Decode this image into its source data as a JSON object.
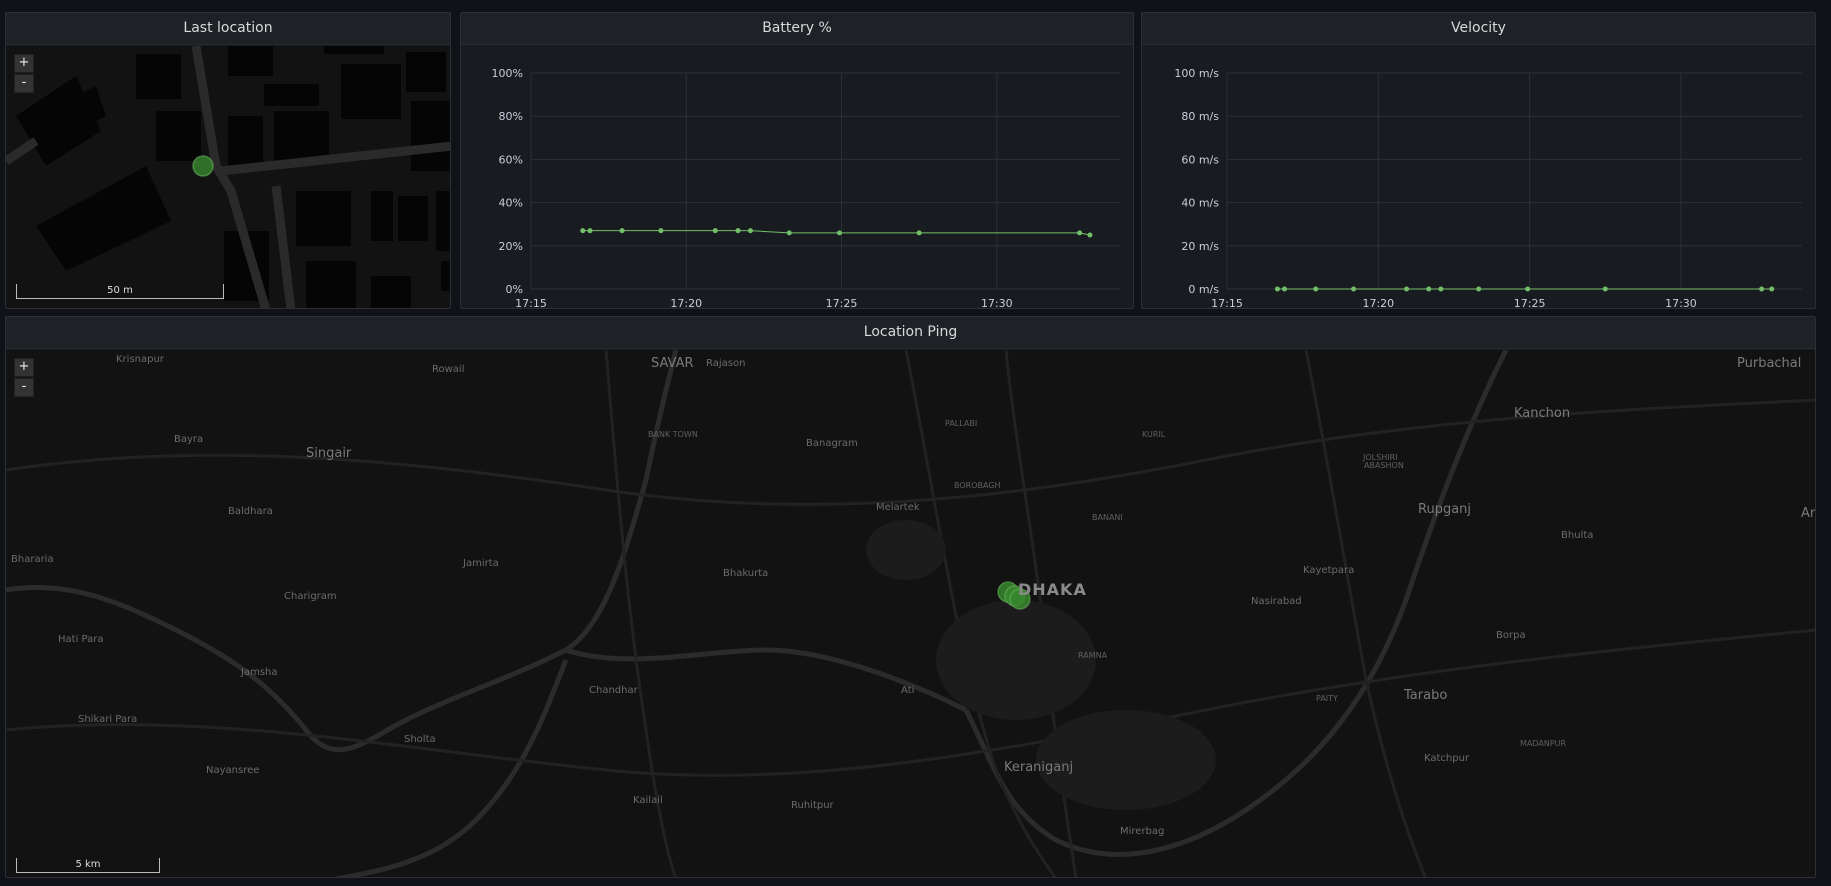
{
  "panels": {
    "last_location": {
      "title": "Last location",
      "zoom_in": "+",
      "zoom_out": "-",
      "scale": "50 m"
    },
    "battery": {
      "title": "Battery %"
    },
    "velocity": {
      "title": "Velocity"
    },
    "location_ping": {
      "title": "Location Ping",
      "zoom_in": "+",
      "zoom_out": "-",
      "scale": "5 km",
      "places": [
        {
          "name": "Krisnapur",
          "cls": ""
        },
        {
          "name": "Rowail",
          "cls": ""
        },
        {
          "name": "SAVAR",
          "cls": "big"
        },
        {
          "name": "Rajason",
          "cls": ""
        },
        {
          "name": "Purbachal",
          "cls": "big"
        },
        {
          "name": "Kanchon",
          "cls": "big"
        },
        {
          "name": "Bayra",
          "cls": ""
        },
        {
          "name": "Singair",
          "cls": "big"
        },
        {
          "name": "BANK TOWN",
          "cls": "sm"
        },
        {
          "name": "Banagram",
          "cls": ""
        },
        {
          "name": "PALLABI",
          "cls": "sm"
        },
        {
          "name": "KURIL",
          "cls": "sm"
        },
        {
          "name": "JOLSHIRI",
          "cls": "sm"
        },
        {
          "name": "ABASHON",
          "cls": "sm"
        },
        {
          "name": "BOROBAGH",
          "cls": "sm"
        },
        {
          "name": "Baldhara",
          "cls": ""
        },
        {
          "name": "Melartek",
          "cls": ""
        },
        {
          "name": "BANANI",
          "cls": "sm"
        },
        {
          "name": "Rupganj",
          "cls": "big"
        },
        {
          "name": "Bhulta",
          "cls": ""
        },
        {
          "name": "Ara",
          "cls": "big"
        },
        {
          "name": "Bhararia",
          "cls": ""
        },
        {
          "name": "Jamirta",
          "cls": ""
        },
        {
          "name": "Bhakurta",
          "cls": ""
        },
        {
          "name": "DHAKA",
          "cls": "city"
        },
        {
          "name": "Kayetpara",
          "cls": ""
        },
        {
          "name": "Charigram",
          "cls": ""
        },
        {
          "name": "Nasirabad",
          "cls": ""
        },
        {
          "name": "Hati Para",
          "cls": ""
        },
        {
          "name": "Borpa",
          "cls": ""
        },
        {
          "name": "RAMNA",
          "cls": "sm"
        },
        {
          "name": "Jamsha",
          "cls": ""
        },
        {
          "name": "Chandhar",
          "cls": ""
        },
        {
          "name": "Ati",
          "cls": ""
        },
        {
          "name": "PAITY",
          "cls": "sm"
        },
        {
          "name": "Tarabo",
          "cls": "big"
        },
        {
          "name": "Shikari Para",
          "cls": ""
        },
        {
          "name": "Sholta",
          "cls": ""
        },
        {
          "name": "MADANPUR",
          "cls": "sm"
        },
        {
          "name": "Katchpur",
          "cls": ""
        },
        {
          "name": "Nayansree",
          "cls": ""
        },
        {
          "name": "Keraniganj",
          "cls": "big"
        },
        {
          "name": "Kailail",
          "cls": ""
        },
        {
          "name": "Ruhitpur",
          "cls": ""
        },
        {
          "name": "Mirerbag",
          "cls": ""
        }
      ]
    }
  },
  "colors": {
    "series": "#73bf69",
    "panel_bg": "#181b1f",
    "grid": "#2c2f35"
  },
  "chart_data": [
    {
      "type": "line",
      "title": "Battery %",
      "x_ticks": [
        "17:15",
        "17:20",
        "17:25",
        "17:30"
      ],
      "y_ticks": [
        "0%",
        "20%",
        "40%",
        "60%",
        "80%",
        "100%"
      ],
      "xlim": [
        "17:15",
        "17:34"
      ],
      "ylim": [
        0,
        100
      ],
      "grid": true,
      "series": [
        {
          "x": [
            "17:16:40",
            "17:16:54",
            "17:17:56",
            "17:19:11",
            "17:20:56",
            "17:21:40",
            "17:22:04",
            "17:23:19",
            "17:24:56",
            "17:27:30",
            "17:32:40",
            "17:33:00"
          ],
          "values": [
            27,
            27,
            27,
            27,
            27,
            27,
            27,
            26,
            26,
            26,
            26,
            25
          ]
        }
      ]
    },
    {
      "type": "line",
      "title": "Velocity",
      "x_ticks": [
        "17:15",
        "17:20",
        "17:25",
        "17:30"
      ],
      "y_ticks": [
        "0 m/s",
        "20 m/s",
        "40 m/s",
        "60 m/s",
        "80 m/s",
        "100 m/s"
      ],
      "xlim": [
        "17:15",
        "17:34"
      ],
      "ylim": [
        0,
        100
      ],
      "grid": true,
      "series": [
        {
          "x": [
            "17:16:40",
            "17:16:54",
            "17:17:56",
            "17:19:11",
            "17:20:56",
            "17:21:40",
            "17:22:04",
            "17:23:19",
            "17:24:56",
            "17:27:30",
            "17:32:40",
            "17:33:00"
          ],
          "values": [
            0,
            0,
            0,
            0,
            0,
            0,
            0,
            0,
            0,
            0,
            0,
            0
          ]
        }
      ]
    }
  ]
}
